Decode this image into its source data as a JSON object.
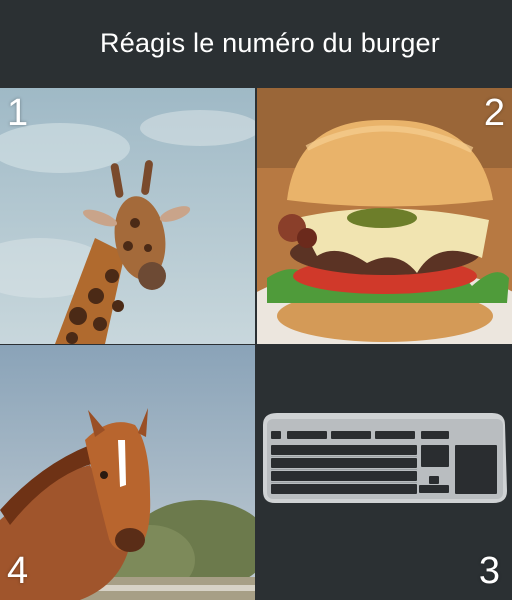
{
  "header": {
    "title": "Réagis le numéro du burger"
  },
  "tiles": [
    {
      "number": "1",
      "subject": "giraffe"
    },
    {
      "number": "2",
      "subject": "burger"
    },
    {
      "number": "3",
      "subject": "keyboard"
    },
    {
      "number": "4",
      "subject": "horse"
    }
  ],
  "colors": {
    "background": "#2b3033",
    "text": "#ffffff"
  }
}
